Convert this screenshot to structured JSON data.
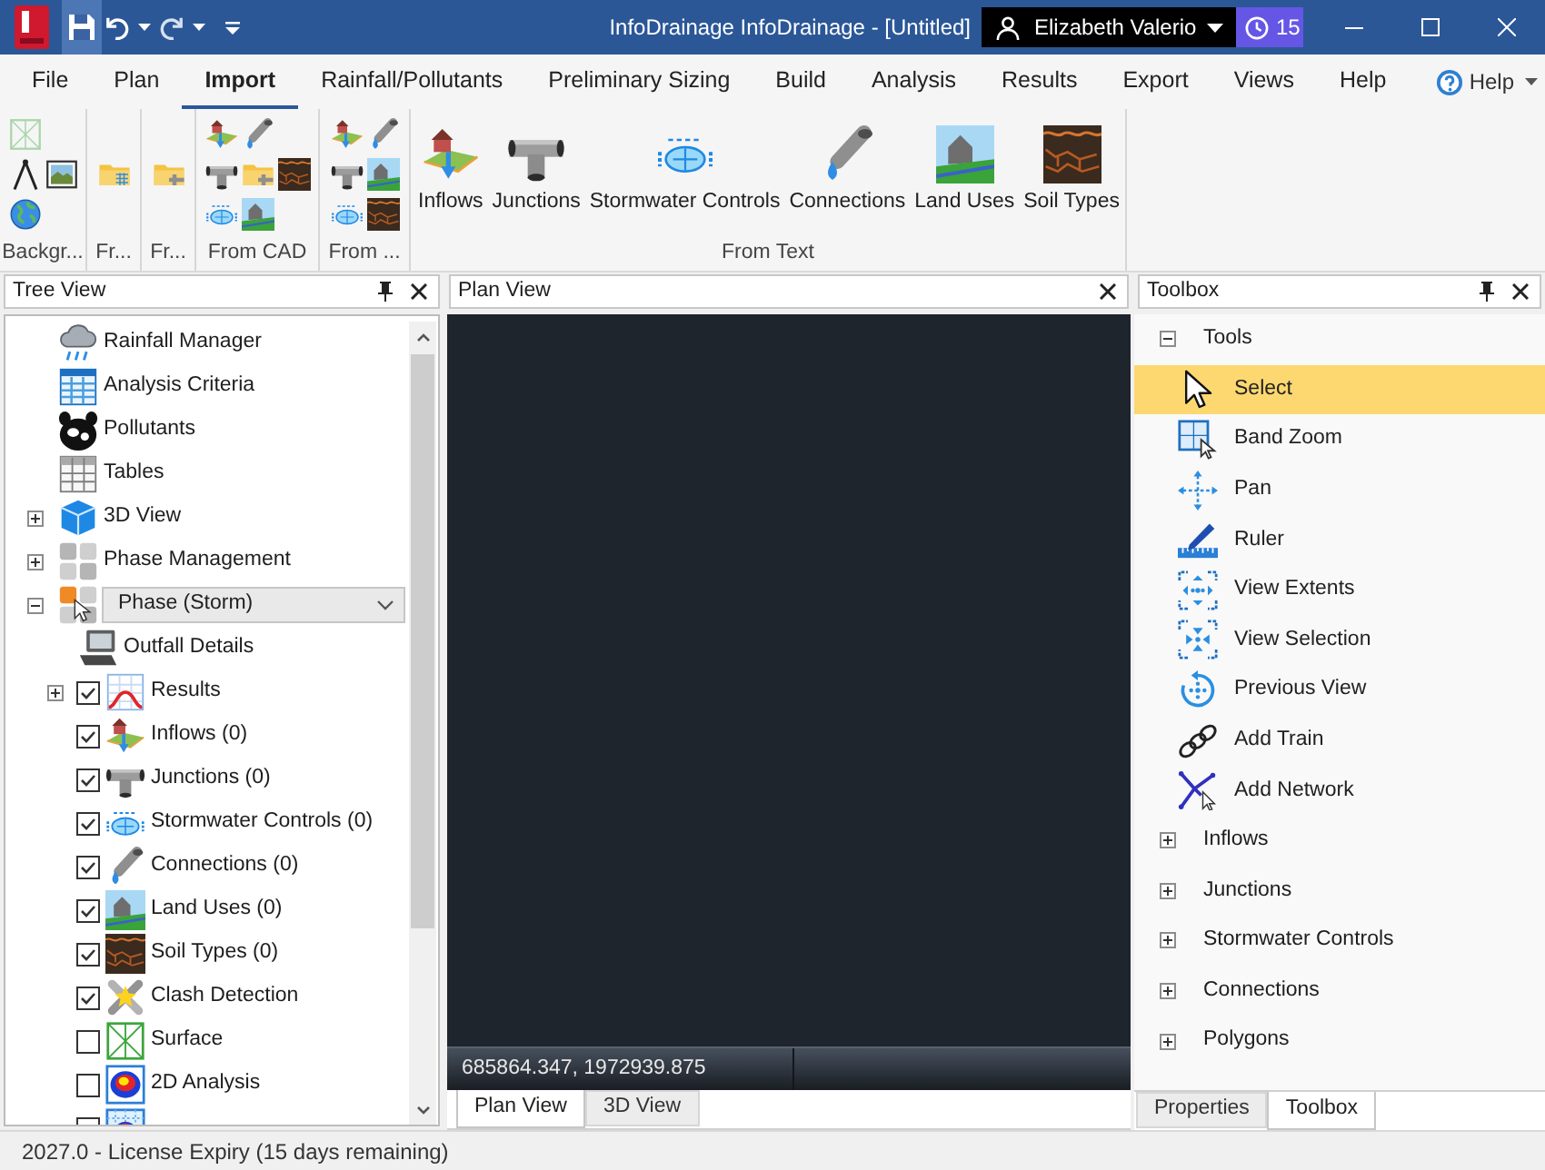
{
  "window": {
    "title": "InfoDrainage InfoDrainage - [Untitled]"
  },
  "quick_access": [
    {
      "kind": "save",
      "highlighted": true
    },
    {
      "kind": "undo",
      "highlighted": false
    },
    {
      "kind": "dropdown",
      "highlighted": false
    },
    {
      "kind": "redo",
      "highlighted": false
    },
    {
      "kind": "dropdown",
      "highlighted": false
    },
    {
      "kind": "customize",
      "highlighted": false
    }
  ],
  "account": {
    "name": "Elizabeth Valerio",
    "badge": "15"
  },
  "menu_tabs": [
    {
      "label": "File",
      "selected": false
    },
    {
      "label": "Plan",
      "selected": false
    },
    {
      "label": "Import",
      "selected": true
    },
    {
      "label": "Rainfall/Pollutants",
      "selected": false
    },
    {
      "label": "Preliminary Sizing",
      "selected": false
    },
    {
      "label": "Build",
      "selected": false
    },
    {
      "label": "Analysis",
      "selected": false
    },
    {
      "label": "Results",
      "selected": false
    },
    {
      "label": "Export",
      "selected": false
    },
    {
      "label": "Views",
      "selected": false
    },
    {
      "label": "Help",
      "selected": false
    }
  ],
  "help_menu": {
    "label": "Help"
  },
  "ribbon": {
    "groups": [
      {
        "kind": "small",
        "label": "Backgr...",
        "tools": [
          {
            "disabled": true
          },
          {
            "disabled": false
          },
          {
            "disabled": false
          },
          {
            "disabled": false
          }
        ]
      },
      {
        "kind": "small",
        "label": "Fr...",
        "tools": [
          {
            "disabled": false
          }
        ]
      },
      {
        "kind": "small",
        "label": "Fr...",
        "tools": [
          {
            "disabled": false
          }
        ]
      },
      {
        "kind": "small",
        "label": "From CAD",
        "tools": [
          {
            "disabled": false
          },
          {
            "disabled": false
          },
          {
            "disabled": false
          },
          {
            "disabled": false
          },
          {
            "disabled": false
          },
          {
            "disabled": false
          },
          {
            "disabled": false
          }
        ]
      },
      {
        "kind": "small",
        "label": "From ...",
        "tools": [
          {
            "disabled": false
          },
          {
            "disabled": false
          },
          {
            "disabled": false
          },
          {
            "disabled": false
          },
          {
            "disabled": false
          },
          {
            "disabled": false
          }
        ]
      },
      {
        "kind": "large",
        "label": "From Text",
        "buttons": [
          {
            "label": "Inflows"
          },
          {
            "label": "Junctions"
          },
          {
            "label": "Stormwater Controls"
          },
          {
            "label": "Connections"
          },
          {
            "label": "Land Uses"
          },
          {
            "label": "Soil Types"
          }
        ]
      }
    ]
  },
  "tree_view": {
    "title": "Tree View",
    "items": [
      {
        "kind": "plain",
        "label": "Rainfall Manager"
      },
      {
        "kind": "plain",
        "label": "Analysis Criteria"
      },
      {
        "kind": "plain",
        "label": "Pollutants"
      },
      {
        "kind": "plain",
        "label": "Tables"
      },
      {
        "kind": "plain",
        "label": "3D View",
        "expanded": false
      },
      {
        "kind": "plain",
        "label": "Phase Management",
        "expanded": false
      },
      {
        "kind": "combo",
        "label": "Phase (Storm)",
        "expanded": true,
        "children": [
          {
            "kind": "plain",
            "label": "Outfall Details"
          },
          {
            "kind": "check",
            "label": "Results",
            "checked": true,
            "expanded": false
          },
          {
            "kind": "check",
            "label": "Inflows (0)",
            "checked": true
          },
          {
            "kind": "check",
            "label": "Junctions (0)",
            "checked": true
          },
          {
            "kind": "check",
            "label": "Stormwater Controls (0)",
            "checked": true
          },
          {
            "kind": "check",
            "label": "Connections (0)",
            "checked": true
          },
          {
            "kind": "check",
            "label": "Land Uses (0)",
            "checked": true
          },
          {
            "kind": "check",
            "label": "Soil Types (0)",
            "checked": true
          },
          {
            "kind": "check",
            "label": "Clash Detection",
            "checked": true
          },
          {
            "kind": "check",
            "label": "Surface",
            "checked": false
          },
          {
            "kind": "check",
            "label": "2D Analysis",
            "checked": false
          },
          {
            "kind": "check",
            "checked": false
          }
        ]
      }
    ]
  },
  "plan_view": {
    "title": "Plan View",
    "coordinates": "685864.347, 1972939.875",
    "tabs": [
      {
        "label": "Plan View",
        "selected": true
      },
      {
        "label": "3D View",
        "selected": false
      }
    ]
  },
  "toolbox": {
    "title": "Toolbox",
    "sections": [
      {
        "label": "Tools",
        "expanded": true,
        "items": [
          {
            "label": "Select",
            "selected": true
          },
          {
            "label": "Band Zoom",
            "selected": false
          },
          {
            "label": "Pan",
            "selected": false
          },
          {
            "label": "Ruler",
            "selected": false
          },
          {
            "label": "View Extents",
            "selected": false
          },
          {
            "label": "View Selection",
            "selected": false
          },
          {
            "label": "Previous View",
            "selected": false
          },
          {
            "label": "Add Train",
            "selected": false
          },
          {
            "label": "Add Network",
            "selected": false
          }
        ]
      },
      {
        "label": "Inflows",
        "expanded": false
      },
      {
        "label": "Junctions",
        "expanded": false
      },
      {
        "label": "Stormwater Controls",
        "expanded": false
      },
      {
        "label": "Connections",
        "expanded": false
      },
      {
        "label": "Polygons",
        "expanded": false
      }
    ],
    "tabs": [
      {
        "label": "Properties",
        "selected": false
      },
      {
        "label": "Toolbox",
        "selected": true
      }
    ]
  },
  "status_bar": {
    "text": "2027.0 - License Expiry (15 days remaining)"
  }
}
